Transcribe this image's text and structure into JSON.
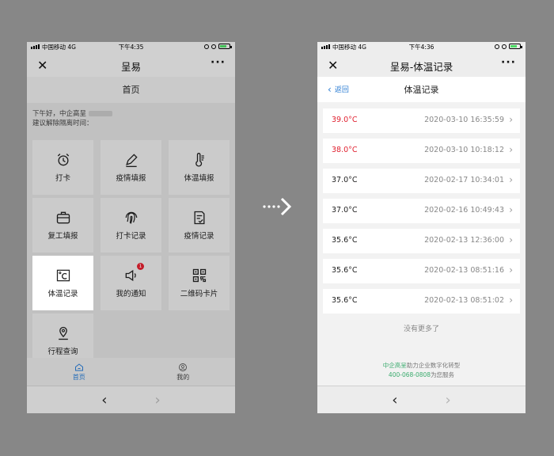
{
  "left_phone": {
    "status": {
      "carrier": "中国移动",
      "network": "4G",
      "time": "下午4:35"
    },
    "nav": {
      "close": "✕",
      "title": "呈易",
      "more": "···"
    },
    "header_title": "首页",
    "greeting": "下午好，中企高呈",
    "greeting_line2": "建议解除隔离时间：",
    "tiles": [
      {
        "label": "打卡",
        "icon": "alarm-clock-icon"
      },
      {
        "label": "疫情填报",
        "icon": "pencil-icon"
      },
      {
        "label": "体温填报",
        "icon": "thermometer-icon"
      },
      {
        "label": "复工填报",
        "icon": "briefcase-icon"
      },
      {
        "label": "打卡记录",
        "icon": "fingerprint-icon"
      },
      {
        "label": "疫情记录",
        "icon": "document-check-icon"
      },
      {
        "label": "体温记录",
        "icon": "celsius-icon"
      },
      {
        "label": "我的通知",
        "icon": "speaker-icon",
        "badge": "1"
      },
      {
        "label": "二维码卡片",
        "icon": "qr-code-icon"
      },
      {
        "label": "行程查询",
        "icon": "location-pin-icon"
      }
    ],
    "tabs": [
      {
        "label": "首页",
        "icon": "home-icon",
        "active": true
      },
      {
        "label": "我的",
        "icon": "user-icon",
        "active": false
      }
    ],
    "bottom": {
      "back": "‹",
      "forward": "›"
    }
  },
  "right_phone": {
    "status": {
      "carrier": "中国移动",
      "network": "4G",
      "time": "下午4:36"
    },
    "nav": {
      "close": "✕",
      "title": "呈易-体温记录",
      "more": "···"
    },
    "subnav": {
      "back_label": "返回",
      "title": "体温记录"
    },
    "records": [
      {
        "temp": "39.0°C",
        "time": "2020-03-10 16:35:59",
        "high": true
      },
      {
        "temp": "38.0°C",
        "time": "2020-03-10 10:18:12",
        "high": true
      },
      {
        "temp": "37.0°C",
        "time": "2020-02-17 10:34:01",
        "high": false
      },
      {
        "temp": "37.0°C",
        "time": "2020-02-16 10:49:43",
        "high": false
      },
      {
        "temp": "35.6°C",
        "time": "2020-02-13 12:36:00",
        "high": false
      },
      {
        "temp": "35.6°C",
        "time": "2020-02-13 08:51:16",
        "high": false
      },
      {
        "temp": "35.6°C",
        "time": "2020-02-13 08:51:02",
        "high": false
      }
    ],
    "no_more": "没有更多了",
    "footer_brand": "中企高呈",
    "footer_line1_rest": "助力企业数字化转型",
    "footer_phone": "400-068-0808",
    "footer_line2_rest": "为您服务",
    "bottom": {
      "back": "‹",
      "forward": "›"
    }
  },
  "colors": {
    "accent": "#2b7cd3",
    "alert": "#e0202f",
    "brand_green": "#3aab6d",
    "background": "#878787"
  }
}
